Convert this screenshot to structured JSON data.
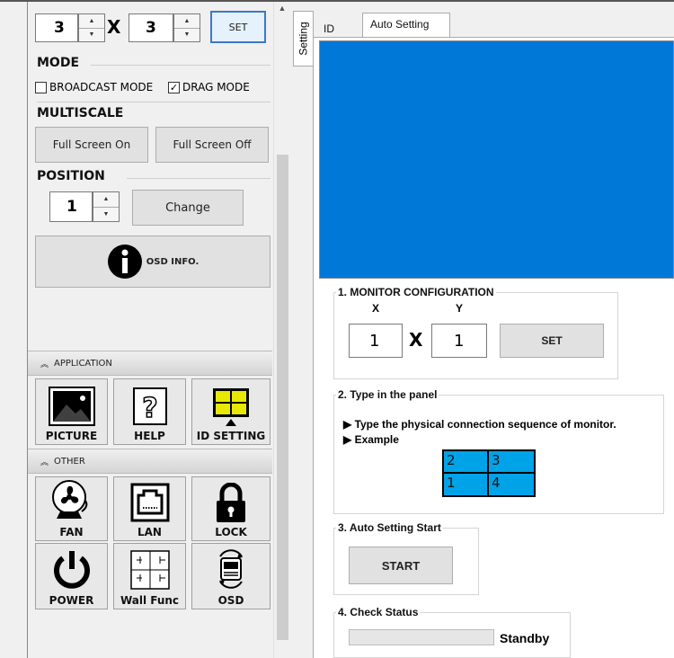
{
  "left": {
    "grid_x": "3",
    "grid_x_sep": "X",
    "grid_y": "3",
    "set_label": "SET",
    "mode_title": "MODE",
    "broadcast_label": "BROADCAST MODE",
    "broadcast_checked": false,
    "drag_label": "DRAG MODE",
    "drag_checked": true,
    "multiscale_title": "MULTISCALE",
    "fullscreen_on": "Full Screen On",
    "fullscreen_off": "Full Screen Off",
    "position_title": "POSITION",
    "position_value": "1",
    "change_label": "Change",
    "osd_info_label": "OSD INFO.",
    "application_header": "APPLICATION",
    "application_tiles": [
      {
        "label": "PICTURE",
        "icon": "picture-icon"
      },
      {
        "label": "HELP",
        "icon": "help-icon"
      },
      {
        "label": "ID SETTING",
        "icon": "id-setting-icon"
      }
    ],
    "other_header": "OTHER",
    "other_tiles": [
      {
        "label": "FAN",
        "icon": "fan-icon"
      },
      {
        "label": "LAN",
        "icon": "lan-icon"
      },
      {
        "label": "LOCK",
        "icon": "lock-icon"
      },
      {
        "label": "POWER",
        "icon": "power-icon"
      },
      {
        "label": "Wall Func",
        "icon": "wall-func-icon"
      },
      {
        "label": "OSD",
        "icon": "osd-icon"
      }
    ]
  },
  "vertical_tab": "Setting",
  "tabs": [
    "ID",
    "Auto Setting"
  ],
  "active_tab": "Auto Setting",
  "preview_color": "#0078d7",
  "monitor_config": {
    "title": "1. MONITOR CONFIGURATION",
    "x_label": "X",
    "y_label": "Y",
    "x_value": "1",
    "sep": "X",
    "y_value": "1",
    "set_label": "SET"
  },
  "panel": {
    "title": "2. Type in the panel",
    "line1": "▶ Type the physical connection sequence of monitor.",
    "line2": "▶ Example",
    "example_cells": [
      "2",
      "3",
      "1",
      "4"
    ],
    "cell_color": "#00a3e8"
  },
  "auto_start": {
    "title": "3. Auto Setting Start",
    "button": "START"
  },
  "check_status": {
    "title": "4. Check Status",
    "progress": 0,
    "status": "Standby"
  }
}
